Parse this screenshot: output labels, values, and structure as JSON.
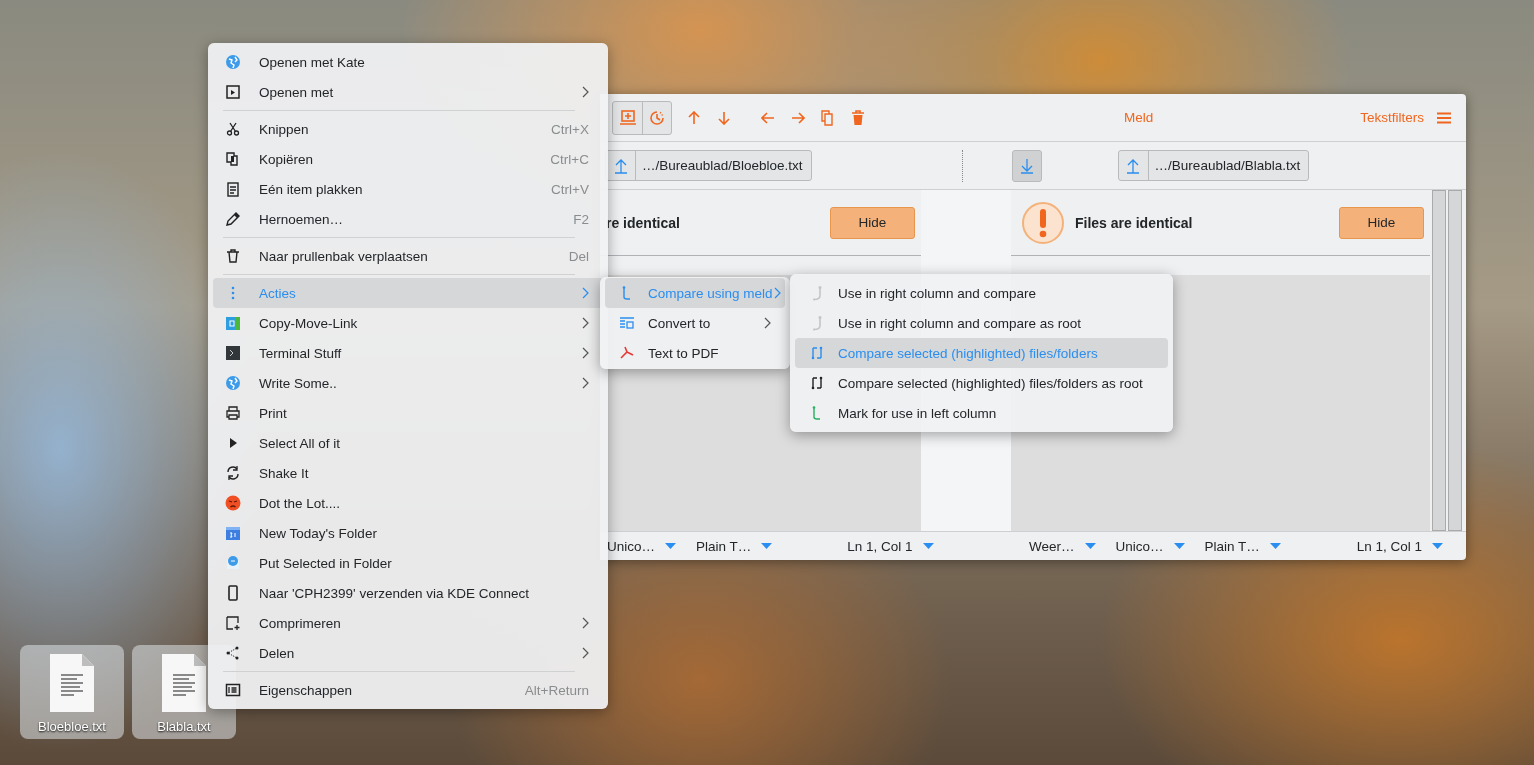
{
  "desktop_icons": [
    {
      "label": "Bloebloe.txt"
    },
    {
      "label": "Blabla.txt"
    }
  ],
  "meld_window": {
    "title": "Meld",
    "filters": "Tekstfilters",
    "panes": [
      {
        "path": "…/Bureaublad/Bloebloe.txt",
        "message": "re identical",
        "hide": "Hide",
        "warning_icon": false,
        "status": [
          "Unico…",
          "Plain T…",
          "Ln 1, Col 1"
        ]
      },
      {
        "path": "…/Bureaublad/Blabla.txt",
        "message": "Files are identical",
        "hide": "Hide",
        "warning_icon": true,
        "status": [
          "Weer…",
          "Unico…",
          "Plain T…",
          "Ln 1, Col 1"
        ]
      }
    ]
  },
  "context_menu": {
    "sections": [
      [
        {
          "label": "Openen met Kate",
          "submenu": false,
          "selected": false
        },
        {
          "label": "Openen met",
          "submenu": true,
          "selected": false
        }
      ],
      [
        {
          "label": "Knippen",
          "shortcut": "Ctrl+X",
          "submenu": false,
          "selected": false
        },
        {
          "label": "Kopiëren",
          "shortcut": "Ctrl+C",
          "submenu": false,
          "selected": false
        },
        {
          "label": "Eén item plakken",
          "shortcut": "Ctrl+V",
          "submenu": false,
          "selected": false
        },
        {
          "label": "Hernoemen…",
          "shortcut": "F2",
          "submenu": false,
          "selected": false
        }
      ],
      [
        {
          "label": "Naar prullenbak verplaatsen",
          "shortcut": "Del",
          "submenu": false,
          "selected": false
        }
      ],
      [
        {
          "label": "Acties",
          "submenu": true,
          "selected": true
        },
        {
          "label": "Copy-Move-Link",
          "submenu": true,
          "selected": false
        },
        {
          "label": "Terminal Stuff",
          "submenu": true,
          "selected": false
        },
        {
          "label": "Write Some..",
          "submenu": true,
          "selected": false
        },
        {
          "label": "Print",
          "submenu": false,
          "selected": false
        },
        {
          "label": "Select All of it",
          "submenu": false,
          "selected": false
        },
        {
          "label": "Shake It",
          "submenu": false,
          "selected": false
        },
        {
          "label": "Dot the Lot....",
          "submenu": false,
          "selected": false
        },
        {
          "label": "New Today's Folder",
          "submenu": false,
          "selected": false
        },
        {
          "label": "Put Selected in Folder",
          "submenu": false,
          "selected": false
        },
        {
          "label": "Naar 'CPH2399' verzenden via KDE Connect",
          "submenu": false,
          "selected": false
        },
        {
          "label": "Comprimeren",
          "submenu": true,
          "selected": false
        },
        {
          "label": "Delen",
          "submenu": true,
          "selected": false
        }
      ],
      [
        {
          "label": "Eigenschappen",
          "shortcut": "Alt+Return",
          "submenu": false,
          "selected": false
        }
      ]
    ]
  },
  "actions_submenu": [
    {
      "label": "Compare using meld",
      "submenu": true,
      "selected": true
    },
    {
      "label": "Convert to",
      "submenu": true,
      "selected": false
    },
    {
      "label": "Text to PDF",
      "submenu": false,
      "selected": false
    }
  ],
  "meld_submenu": [
    {
      "label": "Use in right column and compare",
      "selected": false
    },
    {
      "label": "Use in right column and compare as root",
      "selected": false
    },
    {
      "label": "Compare selected (highlighted) files/folders",
      "selected": true
    },
    {
      "label": "Compare selected (highlighted) files/folders as root",
      "selected": false
    },
    {
      "label": "Mark for use in left column",
      "selected": false
    }
  ]
}
